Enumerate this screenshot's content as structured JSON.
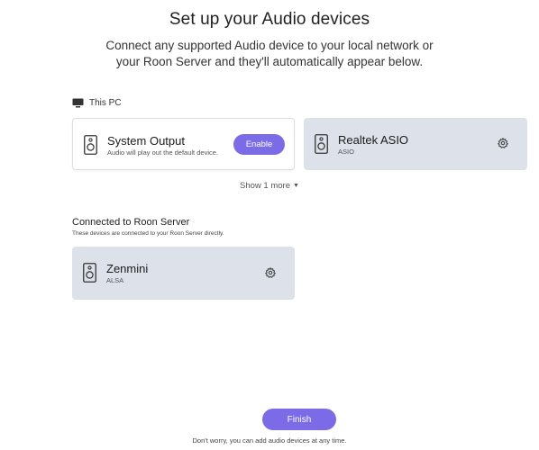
{
  "header": {
    "title": "Set up your Audio devices",
    "subtitle_line1": "Connect any supported Audio device to your local network or",
    "subtitle_line2": "your Roon Server and they'll automatically appear below."
  },
  "this_pc": {
    "label": "This PC",
    "icon": "computer-icon",
    "devices": [
      {
        "name": "System Output",
        "subtitle": "Audio will play out the default device.",
        "action": "Enable",
        "icon": "speaker-icon"
      },
      {
        "name": "Realtek ASIO",
        "subtitle": "ASIO",
        "icon": "speaker-icon",
        "action_icon": "gear-icon"
      }
    ],
    "show_more": "Show 1 more"
  },
  "roon_server": {
    "label": "Connected to Roon Server",
    "sublabel": "These devices are connected to your Roon Server directly.",
    "devices": [
      {
        "name": "Zenmini",
        "subtitle": "ALSA",
        "icon": "speaker-icon",
        "action_icon": "gear-icon"
      }
    ]
  },
  "footer": {
    "finish_label": "Finish",
    "note": "Don't worry, you can add audio devices at any time."
  },
  "colors": {
    "accent": "#7b6be6",
    "card_gray": "#dde1e9",
    "card_white": "#ffffff"
  }
}
